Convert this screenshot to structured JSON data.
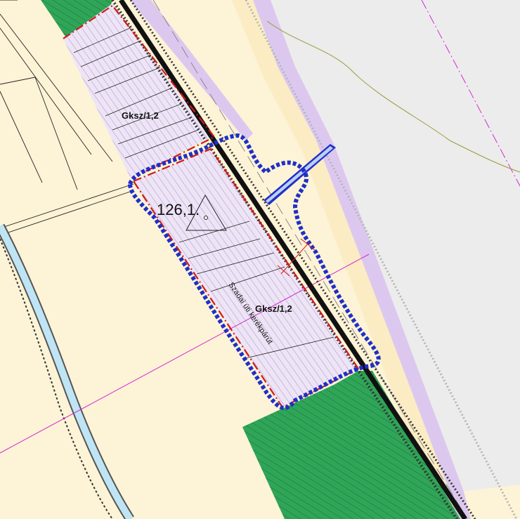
{
  "map": {
    "zone_labels": [
      "Gksz/1,2",
      "Gksz/1,2"
    ],
    "parcel_number": "126,1.",
    "road_text": "Szadai úti kerékpárút"
  },
  "colors": {
    "background": "#fdf3d6",
    "zone_fill": "#ece4f4",
    "zone_hatch": "#b89fd3",
    "green_area": "#33a65a",
    "highlight_outline": "#1f2fc8",
    "zone_boundary": "#d21a1a",
    "road": "#111111",
    "water": "#bfe5f5",
    "purple_line": "#d42bd4",
    "grey_area": "#ededed",
    "lavender_border": "#dcc8ef"
  }
}
